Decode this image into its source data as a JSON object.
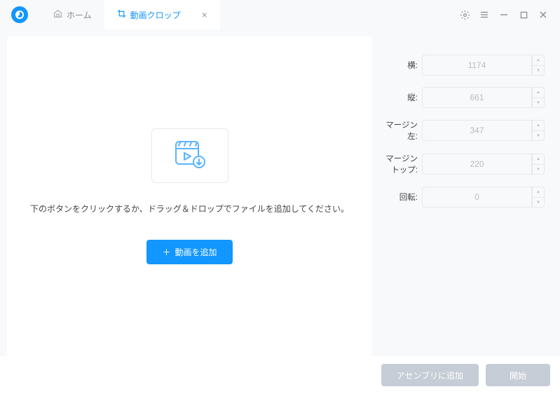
{
  "tabs": {
    "home": "ホーム",
    "crop": "動画クロップ"
  },
  "main": {
    "hint": "下のボタンをクリックするか、ドラッグ＆ドロップでファイルを追加してください。",
    "addButton": "動画を追加"
  },
  "fields": {
    "width": {
      "label": "横:",
      "value": "1174"
    },
    "height": {
      "label": "縦:",
      "value": "661"
    },
    "marginLeft": {
      "label": "マージン左:",
      "value": "347"
    },
    "marginTop": {
      "label": "マージントップ:",
      "value": "220"
    },
    "rotation": {
      "label": "回転:",
      "value": "0"
    }
  },
  "bottom": {
    "addToAssembly": "アセンブリに追加",
    "start": "開始"
  }
}
